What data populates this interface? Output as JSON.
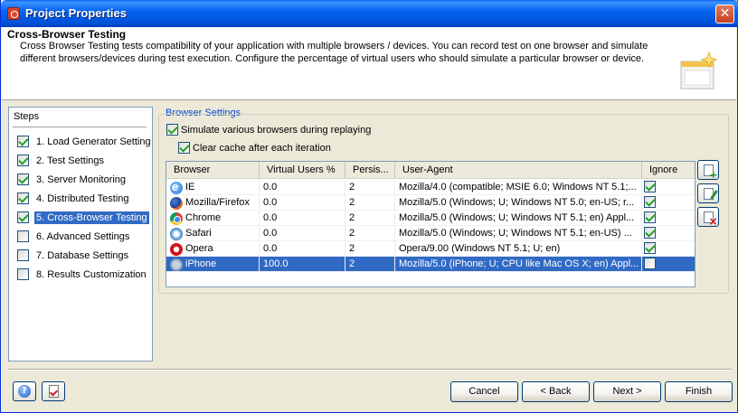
{
  "window": {
    "title": "Project Properties",
    "close_glyph": "✕"
  },
  "header": {
    "title": "Cross-Browser Testing",
    "description": "Cross Browser Testing tests compatibility of your application with multiple browsers / devices. You can record test on one browser and simulate different browsers/devices during test execution. Configure the percentage of virtual users who should simulate a particular browser or device."
  },
  "steps": {
    "title": "Steps",
    "items": [
      {
        "label": "1. Load Generator Setting",
        "checked": true,
        "active": false
      },
      {
        "label": "2. Test Settings",
        "checked": true,
        "active": false
      },
      {
        "label": "3. Server Monitoring",
        "checked": true,
        "active": false
      },
      {
        "label": "4. Distributed Testing",
        "checked": true,
        "active": false
      },
      {
        "label": "5. Cross-Browser Testing",
        "checked": true,
        "active": true
      },
      {
        "label": "6. Advanced Settings",
        "checked": false,
        "active": false
      },
      {
        "label": "7. Database Settings",
        "checked": false,
        "active": false
      },
      {
        "label": "8. Results Customization",
        "checked": false,
        "active": false
      }
    ]
  },
  "browser_settings": {
    "legend": "Browser Settings",
    "simulate_label": "Simulate various browsers during replaying",
    "simulate_checked": true,
    "clear_cache_label": "Clear cache after each iteration",
    "clear_cache_checked": true
  },
  "table": {
    "columns": [
      "Browser",
      "Virtual Users %",
      "Persis...",
      "User-Agent",
      "Ignore"
    ],
    "rows": [
      {
        "icon": "ie-icon",
        "browser": "IE",
        "users": "0.0",
        "persist": "2",
        "agent": "Mozilla/4.0 (compatible; MSIE 6.0; Windows NT 5.1;...",
        "ignore": true,
        "selected": false
      },
      {
        "icon": "firefox-icon",
        "browser": "Mozilla/Firefox",
        "users": "0.0",
        "persist": "2",
        "agent": "Mozilla/5.0 (Windows; U; Windows NT 5.0; en-US; r...",
        "ignore": true,
        "selected": false
      },
      {
        "icon": "chrome-icon",
        "browser": "Chrome",
        "users": "0.0",
        "persist": "2",
        "agent": "Mozilla/5.0 (Windows; U; Windows NT 5.1; en) Appl...",
        "ignore": true,
        "selected": false
      },
      {
        "icon": "safari-icon",
        "browser": "Safari",
        "users": "0.0",
        "persist": "2",
        "agent": "Mozilla/5.0 (Windows; U; Windows NT 5.1; en-US) ...",
        "ignore": true,
        "selected": false
      },
      {
        "icon": "opera-icon",
        "browser": "Opera",
        "users": "0.0",
        "persist": "2",
        "agent": "Opera/9.00 (Windows NT 5.1; U; en)",
        "ignore": true,
        "selected": false
      },
      {
        "icon": "iphone-icon",
        "browser": "iPhone",
        "users": "100.0",
        "persist": "2",
        "agent": "Mozilla/5.0 (iPhone; U; CPU like Mac OS X; en) Appl...",
        "ignore": false,
        "selected": true
      }
    ]
  },
  "side_buttons": [
    "add-browser-icon",
    "edit-browser-icon",
    "delete-browser-icon"
  ],
  "footer": {
    "help_glyph": "?",
    "cancel_label": "Cancel",
    "back_label": "< Back",
    "next_label": "Next >",
    "finish_label": "Finish"
  },
  "colors": {
    "title_bar": "#0055e5",
    "selection": "#316ac5",
    "legend_text": "#0046d5",
    "background": "#ece9d8"
  }
}
